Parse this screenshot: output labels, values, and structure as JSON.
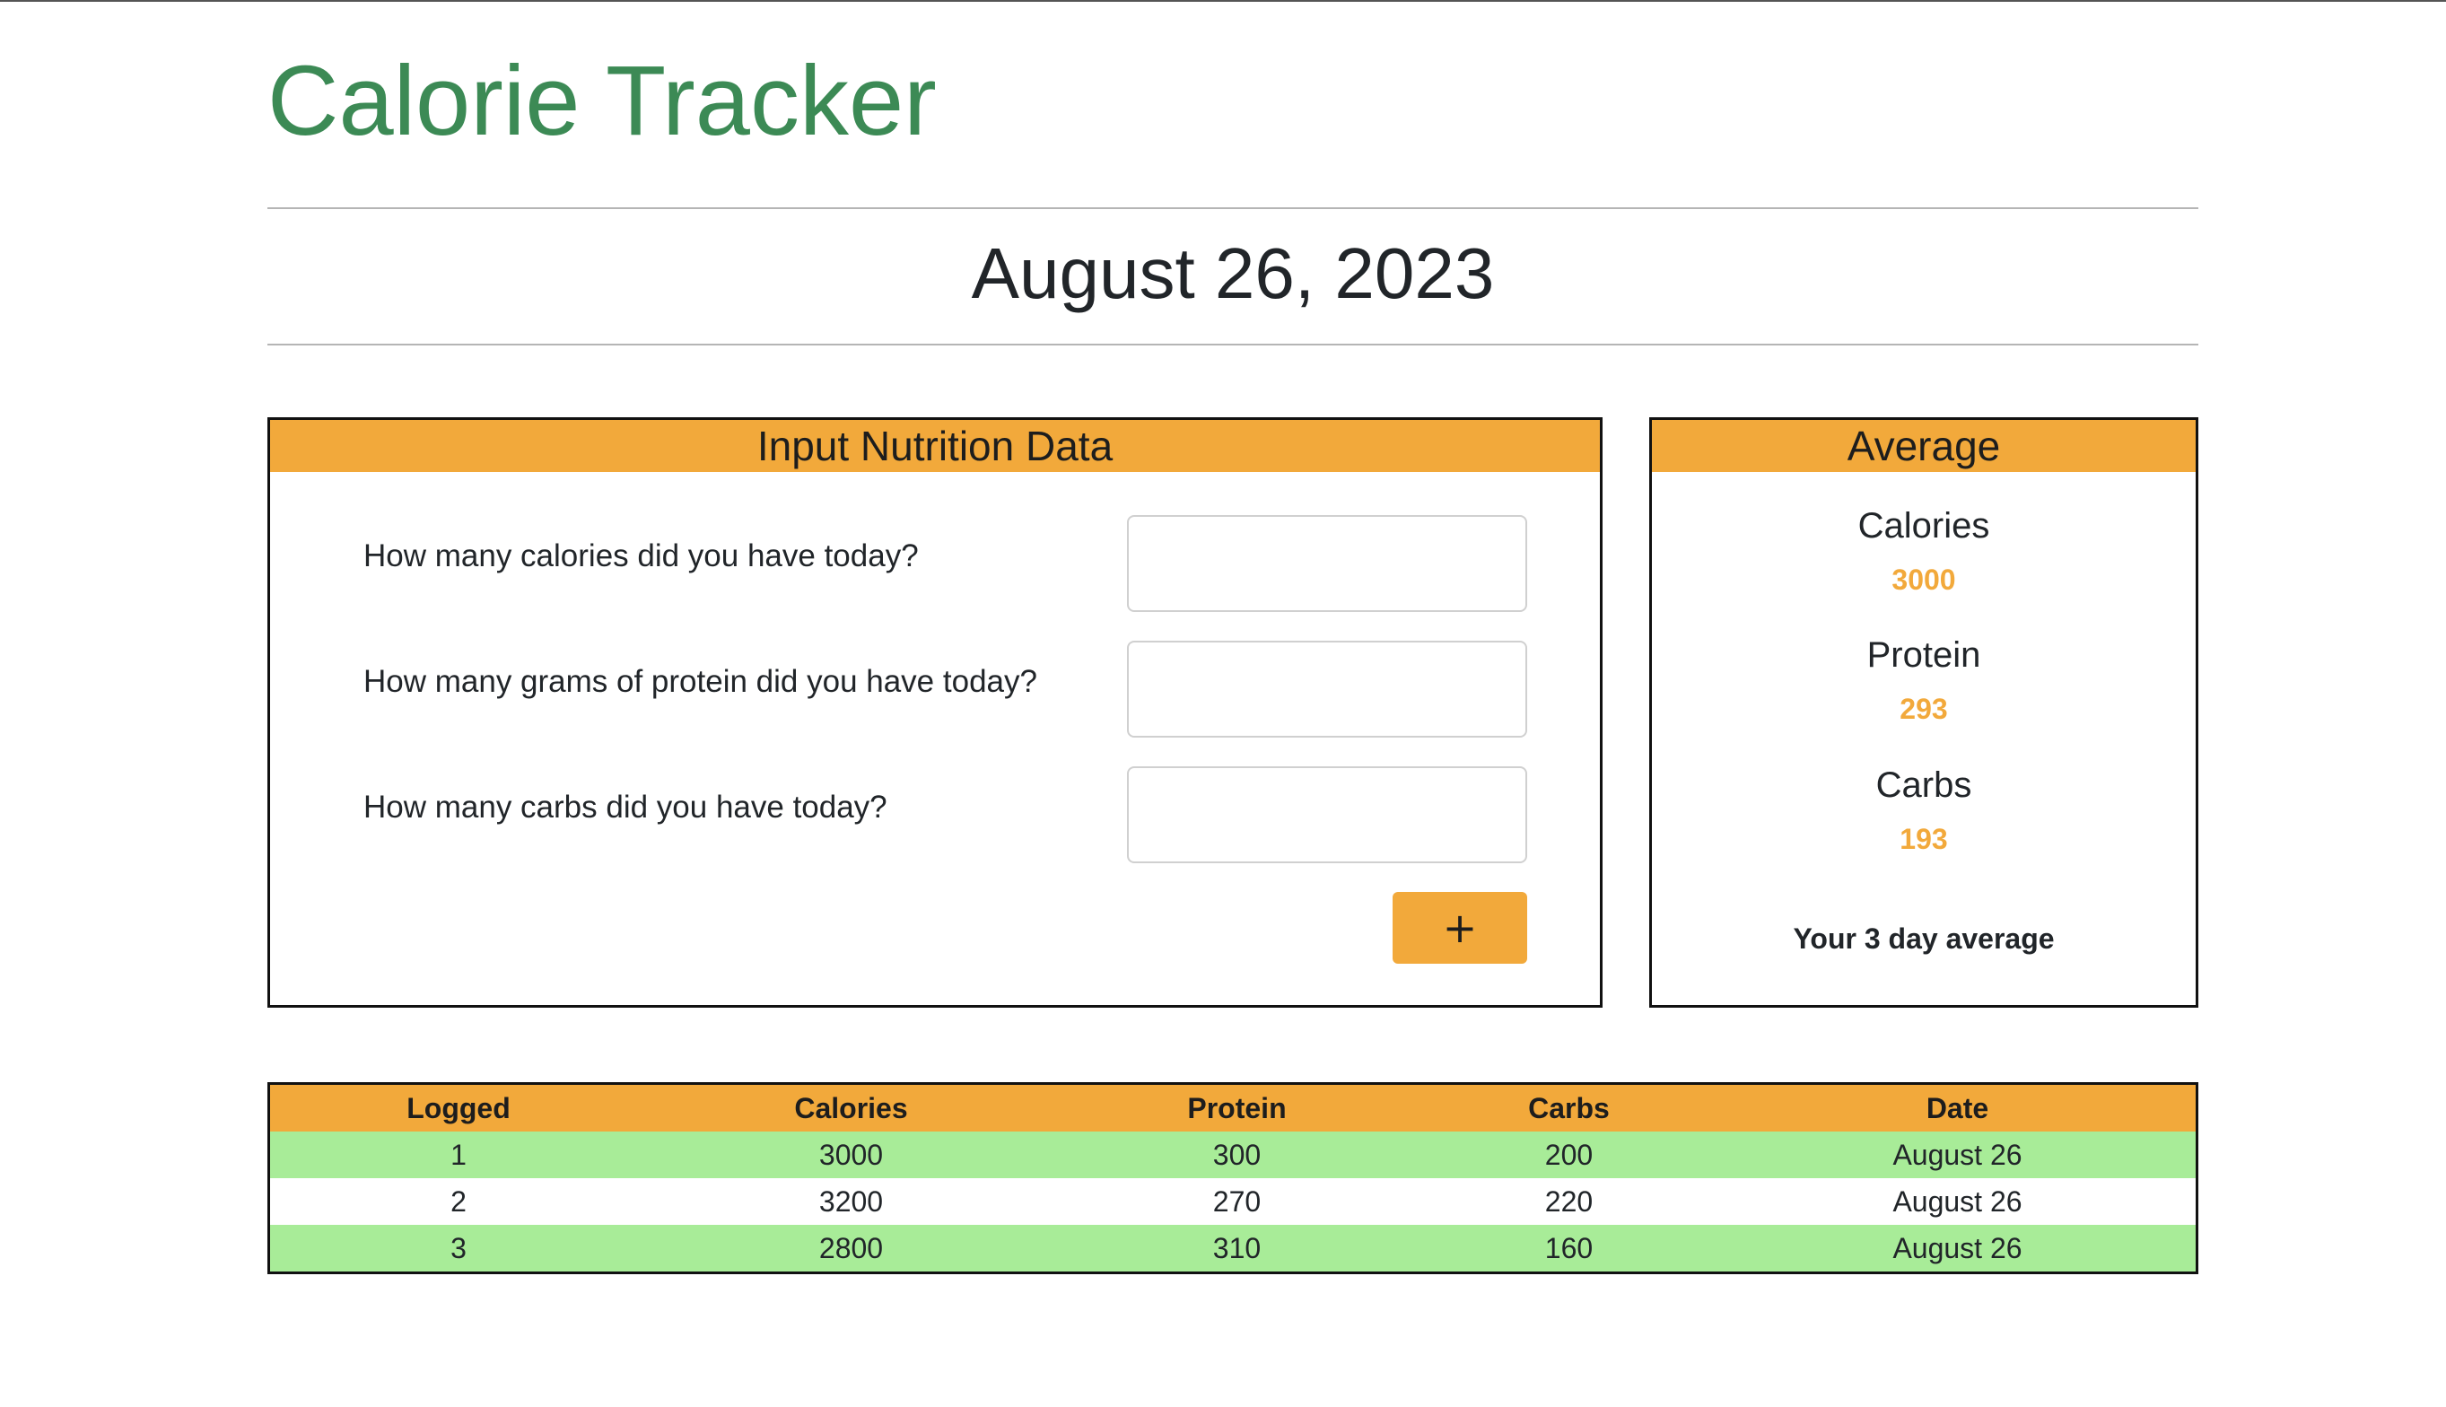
{
  "app": {
    "title": "Calorie Tracker",
    "date": "August 26, 2023"
  },
  "input_panel": {
    "header": "Input Nutrition Data",
    "questions": [
      {
        "label": "How many calories did you have today?",
        "value": "",
        "placeholder": ""
      },
      {
        "label": "How many grams of protein did you have today?",
        "value": "",
        "placeholder": ""
      },
      {
        "label": "How many carbs did you have today?",
        "value": "",
        "placeholder": ""
      }
    ],
    "add_button_label": "+"
  },
  "average_panel": {
    "header": "Average",
    "items": [
      {
        "label": "Calories",
        "value": "3000"
      },
      {
        "label": "Protein",
        "value": "293"
      },
      {
        "label": "Carbs",
        "value": "193"
      }
    ],
    "note": "Your 3 day average"
  },
  "log_table": {
    "columns": [
      "Logged",
      "Calories",
      "Protein",
      "Carbs",
      "Date"
    ],
    "rows": [
      [
        "1",
        "3000",
        "300",
        "200",
        "August 26"
      ],
      [
        "2",
        "3200",
        "270",
        "220",
        "August 26"
      ],
      [
        "3",
        "2800",
        "310",
        "160",
        "August 26"
      ]
    ]
  },
  "colors": {
    "title_green": "#3c8a55",
    "accent_orange": "#f2a93b",
    "row_green": "#a8ec98"
  }
}
